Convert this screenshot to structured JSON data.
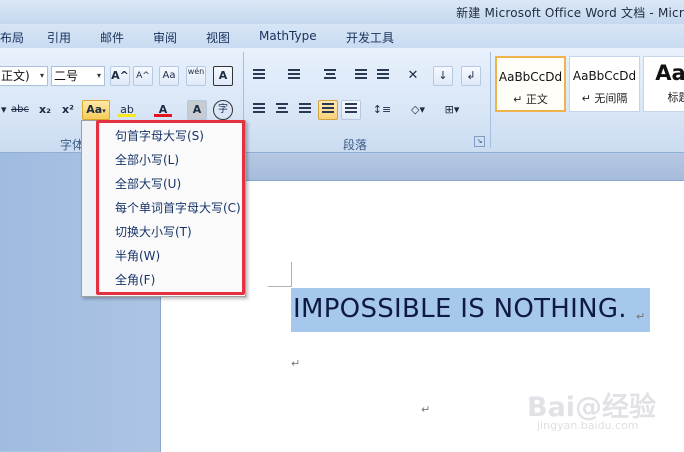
{
  "window": {
    "title": "新建 Microsoft Office Word 文档 - Micr"
  },
  "tabs": [
    "布局",
    "引用",
    "邮件",
    "审阅",
    "视图",
    "MathType",
    "开发工具"
  ],
  "font": {
    "name_value": "正文)",
    "size_value": "二号",
    "grow_icon": "A^",
    "shrink_icon": "A^",
    "clear_icon": "Aa",
    "phonetic_icon": "wén",
    "border_icon": "A",
    "strike_icon": "abc",
    "sub_icon": "x₂",
    "sup_icon": "x²",
    "case_icon": "Aa",
    "color_icon": "A",
    "shade_icon": "A",
    "enclose_icon": "字",
    "group_label": "字体"
  },
  "paragraph": {
    "group_label": "段落"
  },
  "styles": [
    {
      "sample": "AaBbCcDd",
      "name": "↵ 正文"
    },
    {
      "sample": "AaBbCcDd",
      "name": "↵ 无间隔"
    },
    {
      "sample": "AaB",
      "name": "标题"
    }
  ],
  "colors": {
    "highlight_yellow": "#f7e81c",
    "font_red": "#e5141e",
    "frame_red": "#e53040",
    "selection": "#a6c8ec"
  },
  "change_case_menu": [
    "句首字母大写(S)",
    "全部小写(L)",
    "全部大写(U)",
    "每个单词首字母大写(C)",
    "切换大小写(T)",
    "半角(W)",
    "全角(F)"
  ],
  "document": {
    "selected_text": "IMPOSSIBLE IS NOTHING.",
    "para_mark": "↵"
  },
  "watermark": {
    "logo": "Bai@经验",
    "url": "jingyan.baidu.com"
  }
}
